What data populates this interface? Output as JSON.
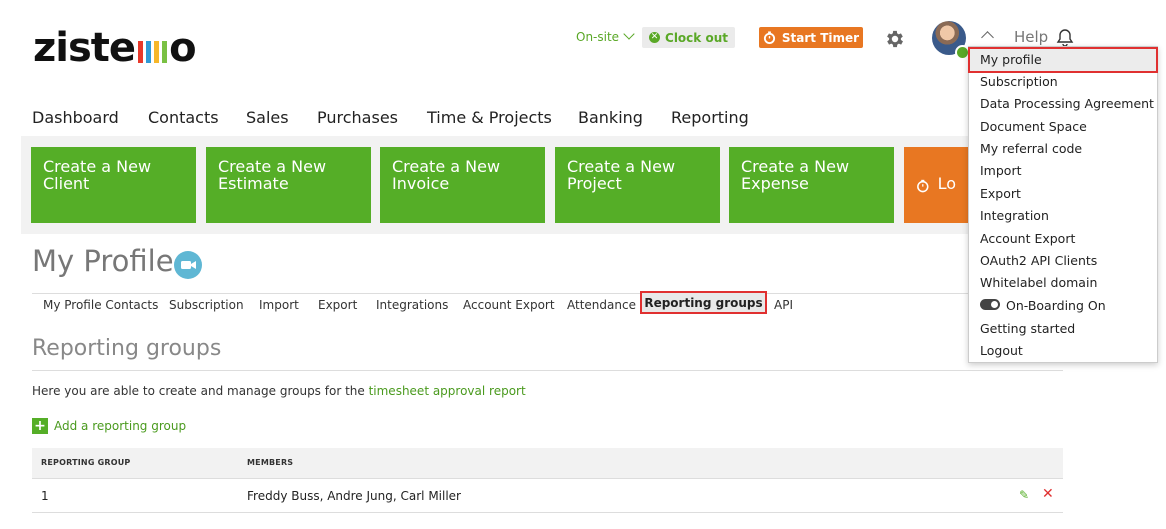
{
  "header": {
    "logo_text_left": "zist",
    "logo_text_right": "e",
    "logo_text_end": "o",
    "logo_colors": [
      "#e8392b",
      "#2f9ad6",
      "#f6b72a",
      "#7ac143"
    ],
    "onsite_label": "On-site",
    "clockout_label": "Clock out",
    "start_timer_label": "Start Timer",
    "help_label": "Help"
  },
  "nav": [
    "Dashboard",
    "Contacts",
    "Sales",
    "Purchases",
    "Time & Projects",
    "Banking",
    "Reporting"
  ],
  "tiles": [
    {
      "line1": "Create a New",
      "line2": "Client"
    },
    {
      "line1": "Create a New",
      "line2": "Estimate"
    },
    {
      "line1": "Create a New",
      "line2": "Invoice"
    },
    {
      "line1": "Create a New",
      "line2": "Project"
    },
    {
      "line1": "Create a New",
      "line2": "Expense"
    },
    {
      "line1": "Lo",
      "line2": ""
    }
  ],
  "page": {
    "title": "My Profile",
    "subtabs": [
      "My Profile Contacts",
      "Subscription",
      "Import",
      "Export",
      "Integrations",
      "Account Export",
      "Attendance",
      "Reporting groups",
      "API"
    ],
    "section_title": "Reporting groups",
    "description_text": "Here you are able to create and manage groups for the ",
    "description_link": "timesheet approval report",
    "add_label": "Add a reporting group"
  },
  "table": {
    "headers": [
      "REPORTING GROUP",
      "MEMBERS"
    ],
    "rows": [
      {
        "group": "1",
        "members": "Freddy Buss, Andre Jung, Carl Miller"
      }
    ]
  },
  "menu": {
    "items": [
      "My profile",
      "Subscription",
      "Data Processing Agreement",
      "Document Space",
      "My referral code",
      "Import",
      "Export",
      "Integration",
      "Account Export",
      "OAuth2 API Clients",
      "Whitelabel domain",
      "On-Boarding On",
      "Getting started",
      "Logout"
    ]
  },
  "colors": {
    "green": "#55ae27",
    "orange": "#e87722",
    "highlight": "#e03030"
  }
}
